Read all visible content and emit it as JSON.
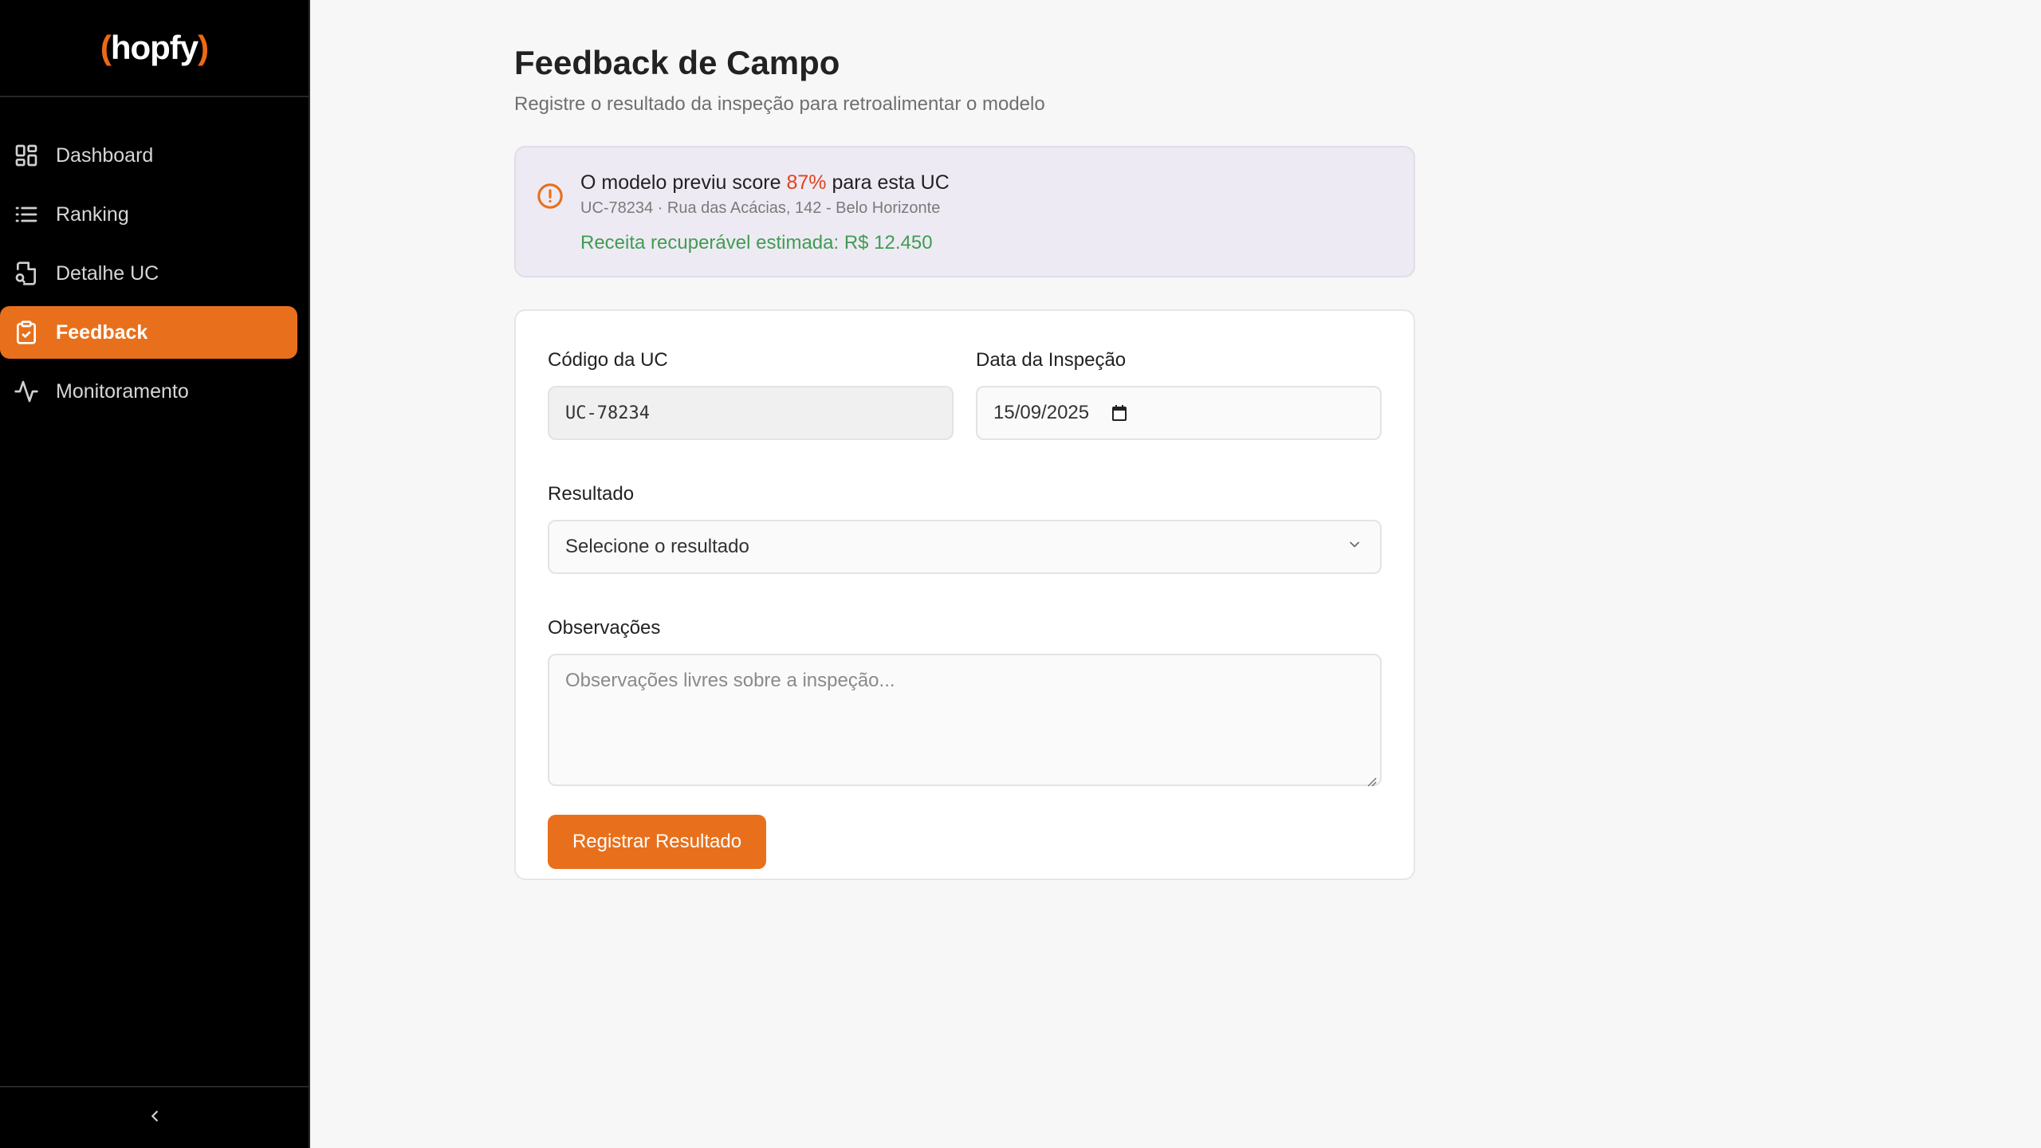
{
  "brand": {
    "name": "hopfy",
    "accent": "#e8701c"
  },
  "sidebar": {
    "items": [
      {
        "label": "Dashboard",
        "icon": "grid-icon"
      },
      {
        "label": "Ranking",
        "icon": "list-icon"
      },
      {
        "label": "Detalhe UC",
        "icon": "document-search-icon"
      },
      {
        "label": "Feedback",
        "icon": "clipboard-check-icon",
        "active": true
      },
      {
        "label": "Monitoramento",
        "icon": "activity-icon"
      }
    ],
    "collapse_icon": "chevron-left-icon"
  },
  "page": {
    "title": "Feedback de Campo",
    "subtitle": "Registre o resultado da inspeção para retroalimentar o modelo"
  },
  "alert": {
    "icon": "alert-circle-icon",
    "prefix": "O modelo previu score",
    "score": "87%",
    "suffix": "para esta UC",
    "details": "UC-78234 · Rua das Acácias, 142 - Belo Horizonte",
    "revenue": "Receita recuperável estimada: R$ 12.450"
  },
  "form": {
    "uc_code_label": "Código da UC",
    "uc_code_value": "UC-78234",
    "date_label": "Data da Inspeção",
    "date_value": "15/09/2025",
    "result_label": "Resultado",
    "result_placeholder": "Selecione o resultado",
    "notes_label": "Observações",
    "notes_placeholder": "Observações livres sobre a inspeção...",
    "submit_label": "Registrar Resultado"
  }
}
